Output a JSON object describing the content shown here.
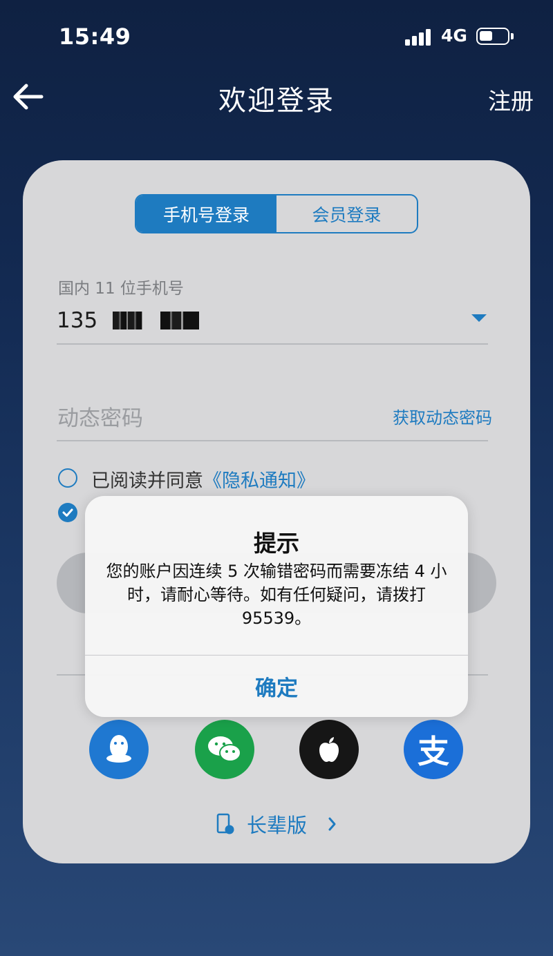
{
  "status_bar": {
    "time": "15:49",
    "network": "4G"
  },
  "nav": {
    "title": "欢迎登录",
    "register_label": "注册",
    "back_icon": "arrow-left-icon"
  },
  "login_tabs": [
    {
      "label": "手机号登录",
      "active": true
    },
    {
      "label": "会员登录",
      "active": false
    }
  ],
  "phone": {
    "label": "国内 11 位手机号",
    "value_visible": "135"
  },
  "otp": {
    "placeholder": "动态密码",
    "get_code_label": "获取动态密码"
  },
  "agreements": {
    "privacy_prefix": "已阅读并同意",
    "privacy_link": "《隐私通知》"
  },
  "social_logins": [
    {
      "icon": "qq-icon",
      "color": "#1f78d1"
    },
    {
      "icon": "wechat-icon",
      "color": "#1aa14a"
    },
    {
      "icon": "apple-icon",
      "color": "#161616"
    },
    {
      "icon": "alipay-icon",
      "color": "#1b6fd8",
      "glyph": "支"
    }
  ],
  "elder_mode": {
    "label": "长辈版",
    "icon": "phone-mode-icon"
  },
  "alert": {
    "title": "提示",
    "message": "您的账户因连续 5 次输错密码而需要冻结 4 小时，请耐心等待。如有任何疑问，请拨打 95539。",
    "confirm_label": "确定"
  },
  "colors": {
    "accent": "#1e7bc0"
  }
}
